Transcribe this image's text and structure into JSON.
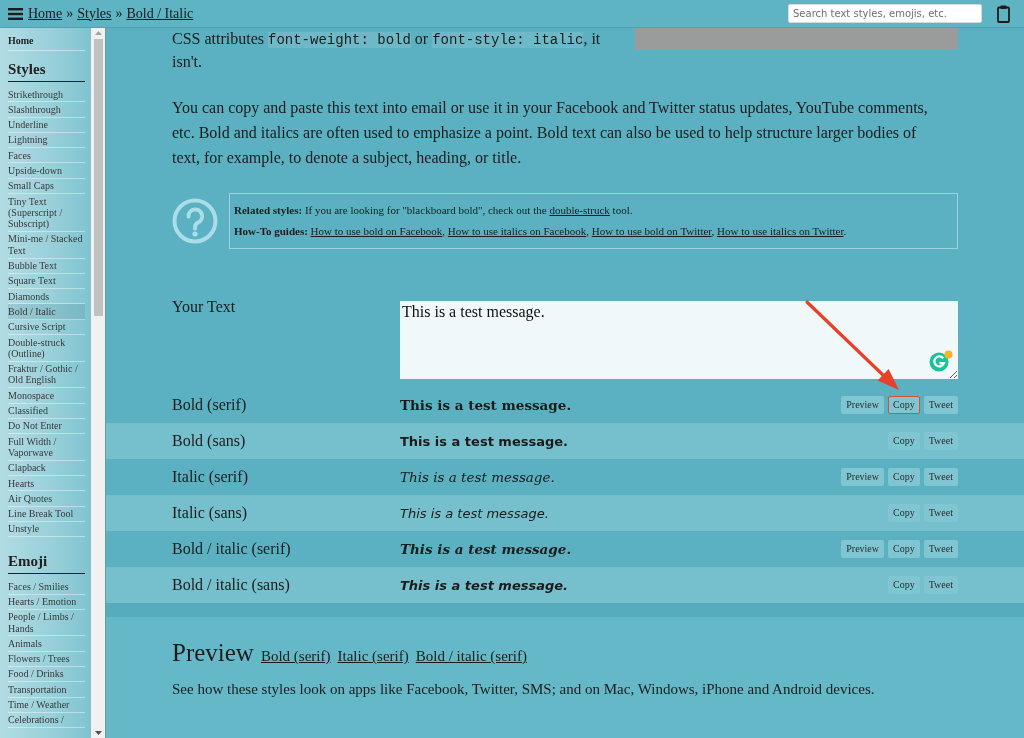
{
  "top_bar": {
    "breadcrumb": [
      {
        "kind": "link",
        "text": "Home"
      },
      {
        "kind": "separator",
        "text": "»"
      },
      {
        "kind": "link",
        "text": "Styles"
      },
      {
        "kind": "separator",
        "text": "»"
      },
      {
        "kind": "link",
        "text": "Bold / Italic"
      }
    ],
    "search": {
      "placeholder": "Search text styles, emojis, etc."
    }
  },
  "sidebar": {
    "home": "Home",
    "sections": [
      {
        "heading": "Styles",
        "items": [
          {
            "label": "Strikethrough",
            "selected": false
          },
          {
            "label": "Slashthrough",
            "selected": false
          },
          {
            "label": "Underline",
            "selected": false
          },
          {
            "label": "Lightning",
            "selected": false
          },
          {
            "label": "Faces",
            "selected": false
          },
          {
            "label": "Upside-down",
            "selected": false
          },
          {
            "label": "Small Caps",
            "selected": false
          },
          {
            "label": "Tiny Text (Superscript / Subscript)",
            "selected": false
          },
          {
            "label": "Mini-me / Stacked Text",
            "selected": false
          },
          {
            "label": "Bubble Text",
            "selected": false
          },
          {
            "label": "Square Text",
            "selected": false
          },
          {
            "label": "Diamonds",
            "selected": false
          },
          {
            "label": "Bold / Italic",
            "selected": true
          },
          {
            "label": "Cursive Script",
            "selected": false
          },
          {
            "label": "Double-struck (Outline)",
            "selected": false
          },
          {
            "label": "Fraktur / Gothic / Old English",
            "selected": false
          },
          {
            "label": "Monospace",
            "selected": false
          },
          {
            "label": "Classified",
            "selected": false
          },
          {
            "label": "Do Not Enter",
            "selected": false
          },
          {
            "label": "Full Width / Vaporwave",
            "selected": false
          },
          {
            "label": "Clapback",
            "selected": false
          },
          {
            "label": "Hearts",
            "selected": false
          },
          {
            "label": "Air Quotes",
            "selected": false
          },
          {
            "label": "Line Break Tool",
            "selected": false
          },
          {
            "label": "Unstyle",
            "selected": false
          }
        ]
      },
      {
        "heading": "Emoji",
        "items": [
          {
            "label": "Faces / Smilies",
            "selected": false
          },
          {
            "label": "Hearts / Emotion",
            "selected": false
          },
          {
            "label": "People / Limbs / Hands",
            "selected": false
          },
          {
            "label": "Animals",
            "selected": false
          },
          {
            "label": "Flowers / Trees",
            "selected": false
          },
          {
            "label": "Food / Drinks",
            "selected": false
          },
          {
            "label": "Transportation",
            "selected": false
          },
          {
            "label": "Time / Weather",
            "selected": false
          },
          {
            "label": "Celebrations /",
            "selected": false
          }
        ]
      }
    ]
  },
  "intro": {
    "parts": [
      {
        "kind": "text",
        "text": "CSS attributes "
      },
      {
        "kind": "code",
        "text": "font-weight: bold"
      },
      {
        "kind": "text",
        "text": " or "
      },
      {
        "kind": "code",
        "text": "font-style: italic"
      },
      {
        "kind": "text",
        "text": ", it isn't."
      }
    ]
  },
  "description": "You can copy and paste this text into email or use it in your Facebook and Twitter status updates, YouTube comments, etc. Bold and italics are often used to emphasize a point. Bold text can also be used to help structure larger bodies of text, for example, to denote a subject, heading, or title.",
  "info_box": {
    "lines": [
      {
        "parts": [
          {
            "kind": "bold",
            "text": "Related styles: "
          },
          {
            "kind": "text",
            "text": "If you are looking for \"blackboard bold\", check out the "
          },
          {
            "kind": "link",
            "text": "double-struck"
          },
          {
            "kind": "text",
            "text": " tool."
          }
        ]
      },
      {
        "parts": [
          {
            "kind": "bold",
            "text": "How-To guides: "
          },
          {
            "kind": "link",
            "text": "How to use bold on Facebook"
          },
          {
            "kind": "text",
            "text": ", "
          },
          {
            "kind": "link",
            "text": "How to use italics on Facebook"
          },
          {
            "kind": "text",
            "text": ", "
          },
          {
            "kind": "link",
            "text": "How to use bold on Twitter"
          },
          {
            "kind": "text",
            "text": ", "
          },
          {
            "kind": "link",
            "text": "How to use italics on Twitter"
          },
          {
            "kind": "text",
            "text": "."
          }
        ]
      }
    ]
  },
  "input": {
    "label": "Your Text",
    "value": "This is a test message."
  },
  "results": [
    {
      "label": "Bold (serif)",
      "kind": "boldserif",
      "output": "This is a test message.",
      "buttons": [
        {
          "label": "Preview",
          "highlighted": false
        },
        {
          "label": "Copy",
          "highlighted": true
        },
        {
          "label": "Tweet",
          "highlighted": false
        }
      ]
    },
    {
      "label": "Bold (sans)",
      "kind": "boldsans",
      "output": "This is a test message.",
      "buttons": [
        {
          "label": "Copy",
          "highlighted": false
        },
        {
          "label": "Tweet",
          "highlighted": false
        }
      ]
    },
    {
      "label": "Italic (serif)",
      "kind": "italicserif",
      "output": "This is a test message.",
      "buttons": [
        {
          "label": "Preview",
          "highlighted": false
        },
        {
          "label": "Copy",
          "highlighted": false
        },
        {
          "label": "Tweet",
          "highlighted": false
        }
      ]
    },
    {
      "label": "Italic (sans)",
      "kind": "italicsans",
      "output": "This is a test message.",
      "buttons": [
        {
          "label": "Copy",
          "highlighted": false
        },
        {
          "label": "Tweet",
          "highlighted": false
        }
      ]
    },
    {
      "label": "Bold / italic (serif)",
      "kind": "bolditalicserif",
      "output": "This is a test message.",
      "buttons": [
        {
          "label": "Preview",
          "highlighted": false
        },
        {
          "label": "Copy",
          "highlighted": false
        },
        {
          "label": "Tweet",
          "highlighted": false
        }
      ]
    },
    {
      "label": "Bold / italic (sans)",
      "kind": "bolditalicsans",
      "output": "This is a test message.",
      "buttons": [
        {
          "label": "Copy",
          "highlighted": false
        },
        {
          "label": "Tweet",
          "highlighted": false
        }
      ]
    }
  ],
  "preview": {
    "title": "Preview",
    "links": [
      "Bold (serif)",
      "Italic (serif)",
      "Bold / italic (serif)"
    ],
    "text": "See how these styles look on apps like Facebook, Twitter, SMS; and on Mac, Windows, iPhone and Android devices."
  }
}
